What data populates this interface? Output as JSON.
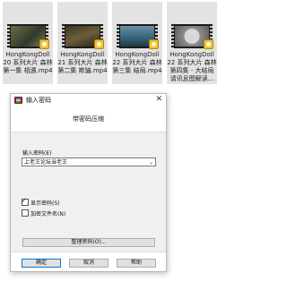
{
  "files": [
    {
      "name": "HongKongDoll 20 系列大片 森林 第一集 相遇.mp4",
      "type_icon": "video-file-icon"
    },
    {
      "name": "HongKongDoll 21 系列大片 森林 第二集 欺骗.mp4",
      "type_icon": "video-file-icon"
    },
    {
      "name": "HongKongDoll 22 系列大片 森林 第三集 结局.mp4",
      "type_icon": "video-file-icon"
    },
    {
      "name": "HongKongDoll 22 系列大片 森林 第四集 - 大结局 请讯息图解读...",
      "type_icon": "video-file-icon"
    }
  ],
  "dialog": {
    "title": "输入密码",
    "section_title": "带密码压缩",
    "password_label": "输入密码(E)",
    "password_value": "上老王论坛当老王",
    "show_password_label": "显示密码(S)",
    "show_password_checked": true,
    "encrypt_names_label": "加密文件名(N)",
    "encrypt_names_checked": false,
    "manage_label": "整理密码(O)...",
    "ok_label": "确定",
    "cancel_label": "取消",
    "help_label": "帮助",
    "close_glyph": "✕"
  }
}
